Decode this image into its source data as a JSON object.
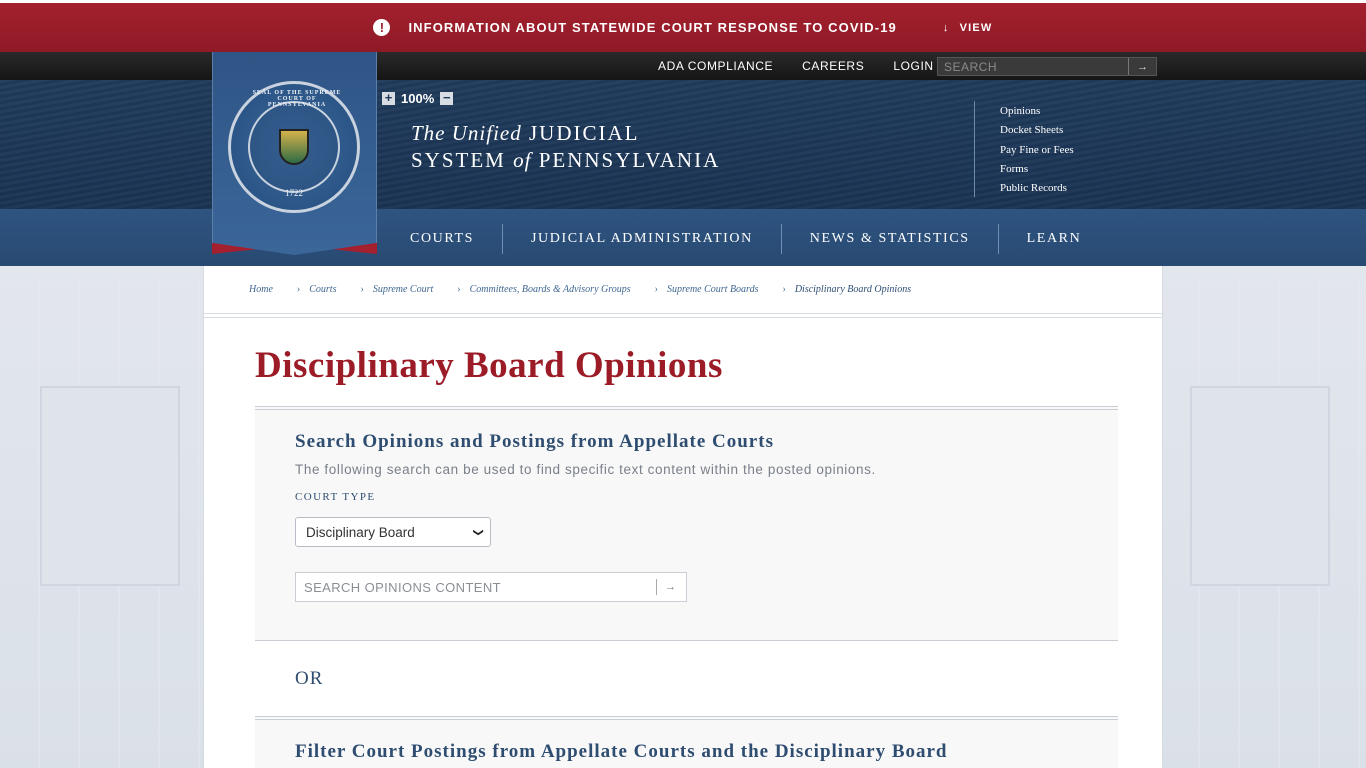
{
  "covid": {
    "alert_icon": "!",
    "text": "INFORMATION ABOUT STATEWIDE COURT RESPONSE TO COVID-19",
    "view_label": "VIEW",
    "view_icon": "arrow-down-icon"
  },
  "utility": {
    "links": [
      "ADA COMPLIANCE",
      "CAREERS",
      "LOGIN"
    ],
    "search_placeholder": "SEARCH"
  },
  "zoom": {
    "level": "100%",
    "plus": "+",
    "minus": "−"
  },
  "seal": {
    "ring_text": "SEAL OF THE SUPREME COURT OF PENNSYLVANIA",
    "year": "1722"
  },
  "logo": {
    "the_unified": "The Unified",
    "judicial": "JUDICIAL",
    "system": "SYSTEM",
    "of": "of",
    "pennsylvania": "PENNSYLVANIA"
  },
  "quick_links": [
    "Opinions",
    "Docket Sheets",
    "Pay Fine or Fees",
    "Forms",
    "Public Records"
  ],
  "main_nav": [
    "COURTS",
    "JUDICIAL ADMINISTRATION",
    "NEWS & STATISTICS",
    "LEARN"
  ],
  "breadcrumb": {
    "items": [
      "Home",
      "Courts",
      "Supreme Court",
      "Committees, Boards & Advisory Groups",
      "Supreme Court Boards"
    ],
    "current": "Disciplinary Board Opinions"
  },
  "page_title": "Disciplinary Board Opinions",
  "search_section": {
    "heading": "Search Opinions and Postings from Appellate Courts",
    "description": "The following search can be used to find specific text content within the posted opinions.",
    "court_type_label": "COURT TYPE",
    "court_type_value": "Disciplinary Board",
    "search_placeholder": "SEARCH OPINIONS CONTENT"
  },
  "or_text": "OR",
  "filter_section": {
    "heading": "Filter Court Postings from Appellate Courts and the Disciplinary Board"
  },
  "colors": {
    "covid_red": "#9a1c29",
    "header_navy": "#1f3a5b",
    "nav_blue": "#2e5480",
    "title_red": "#9b1b26",
    "heading_blue": "#2e4d70"
  }
}
